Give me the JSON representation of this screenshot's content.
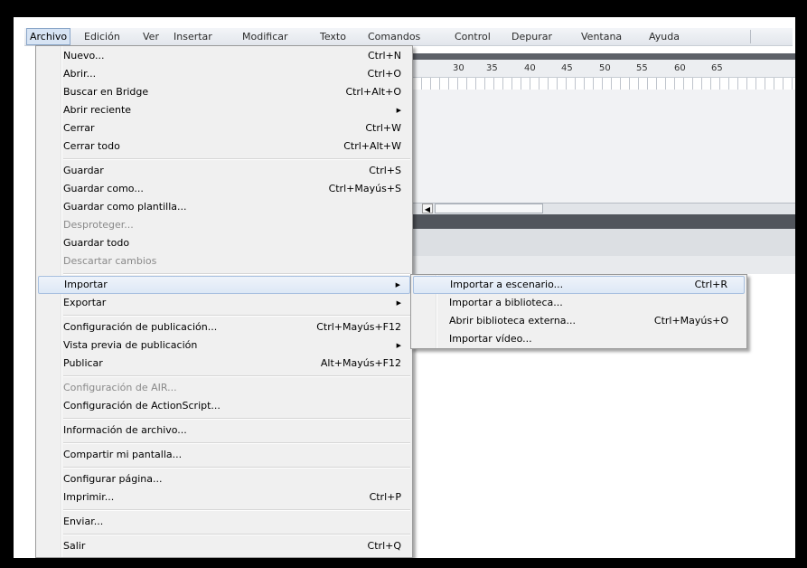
{
  "menubar": {
    "items": [
      "Archivo",
      "Edición",
      "Ver",
      "Insertar",
      "Modificar",
      "Texto",
      "Comandos",
      "Control",
      "Depurar",
      "Ventana",
      "Ayuda"
    ],
    "active": "Archivo"
  },
  "timeline": {
    "ruler_numbers": [
      "30",
      "35",
      "40",
      "45",
      "50",
      "55",
      "60",
      "65"
    ]
  },
  "file_menu": {
    "nuevo": {
      "label": "Nuevo...",
      "shortcut": "Ctrl+N"
    },
    "abrir": {
      "label": "Abrir...",
      "shortcut": "Ctrl+O"
    },
    "bridge": {
      "label": "Buscar en Bridge",
      "shortcut": "Ctrl+Alt+O"
    },
    "reciente": {
      "label": "Abrir reciente"
    },
    "cerrar": {
      "label": "Cerrar",
      "shortcut": "Ctrl+W"
    },
    "cerrar_todo": {
      "label": "Cerrar todo",
      "shortcut": "Ctrl+Alt+W"
    },
    "guardar": {
      "label": "Guardar",
      "shortcut": "Ctrl+S"
    },
    "guardar_como": {
      "label": "Guardar como...",
      "shortcut": "Ctrl+Mayús+S"
    },
    "guardar_plantilla": {
      "label": "Guardar como plantilla..."
    },
    "desproteger": {
      "label": "Desproteger..."
    },
    "guardar_todo": {
      "label": "Guardar todo"
    },
    "descartar": {
      "label": "Descartar cambios"
    },
    "importar": {
      "label": "Importar"
    },
    "exportar": {
      "label": "Exportar"
    },
    "config_publicacion": {
      "label": "Configuración de publicación...",
      "shortcut": "Ctrl+Mayús+F12"
    },
    "vista_previa": {
      "label": "Vista previa de publicación"
    },
    "publicar": {
      "label": "Publicar",
      "shortcut": "Alt+Mayús+F12"
    },
    "config_air": {
      "label": "Configuración de AIR..."
    },
    "config_actionscript": {
      "label": "Configuración de ActionScript..."
    },
    "info_archivo": {
      "label": "Información de archivo..."
    },
    "compartir": {
      "label": "Compartir mi pantalla..."
    },
    "configurar_pagina": {
      "label": "Configurar página..."
    },
    "imprimir": {
      "label": "Imprimir...",
      "shortcut": "Ctrl+P"
    },
    "enviar": {
      "label": "Enviar..."
    },
    "salir": {
      "label": "Salir",
      "shortcut": "Ctrl+Q"
    }
  },
  "import_submenu": {
    "escenario": {
      "label": "Importar a escenario...",
      "shortcut": "Ctrl+R"
    },
    "biblioteca": {
      "label": "Importar a biblioteca..."
    },
    "externa": {
      "label": "Abrir biblioteca externa...",
      "shortcut": "Ctrl+Mayús+O"
    },
    "video": {
      "label": "Importar vídeo..."
    }
  }
}
